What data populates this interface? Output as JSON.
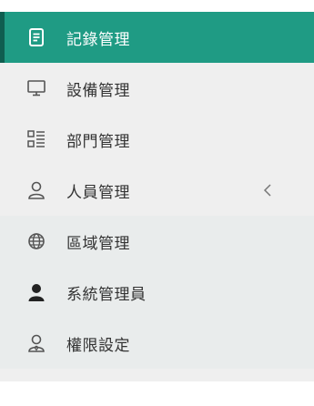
{
  "sidebar": {
    "items": [
      {
        "label": "記錄管理",
        "icon": "document-icon",
        "active": true
      },
      {
        "label": "設備管理",
        "icon": "monitor-icon"
      },
      {
        "label": "部門管理",
        "icon": "list-view-icon"
      },
      {
        "label": "人員管理",
        "icon": "user-outline-icon",
        "expandable": true,
        "chevron": "chevron-left-icon"
      },
      {
        "label": "區域管理",
        "icon": "globe-icon"
      },
      {
        "label": "系統管理員",
        "icon": "user-solid-icon"
      },
      {
        "label": "權限設定",
        "icon": "user-key-icon"
      }
    ]
  },
  "colors": {
    "active_bg": "#1f9b84",
    "active_edge": "#0f5e50",
    "sidebar_bg": "#efefef",
    "submenu_bg": "#e9ecec",
    "text": "#333333"
  }
}
